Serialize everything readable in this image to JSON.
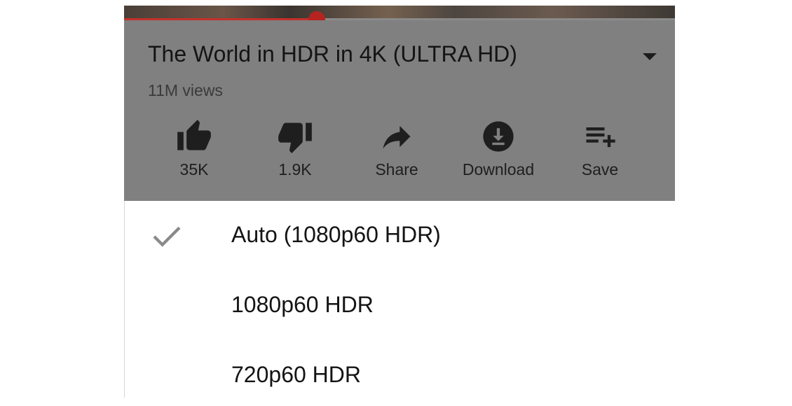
{
  "video": {
    "title": "The World in HDR in 4K (ULTRA HD)",
    "views": "11M views",
    "progress": 0.35
  },
  "actions": [
    {
      "label": "35K",
      "icon": "thumb-up-icon"
    },
    {
      "label": "1.9K",
      "icon": "thumb-down-icon"
    },
    {
      "label": "Share",
      "icon": "share-icon"
    },
    {
      "label": "Download",
      "icon": "download-icon"
    },
    {
      "label": "Save",
      "icon": "playlist-add-icon"
    }
  ],
  "quality_menu": {
    "items": [
      {
        "label": "Auto (1080p60 HDR)",
        "selected": true
      },
      {
        "label": "1080p60 HDR",
        "selected": false
      },
      {
        "label": "720p60 HDR",
        "selected": false
      }
    ]
  },
  "colors": {
    "accent": "#c4302b",
    "overlay": "#808080",
    "check": "#8a8a8a"
  }
}
